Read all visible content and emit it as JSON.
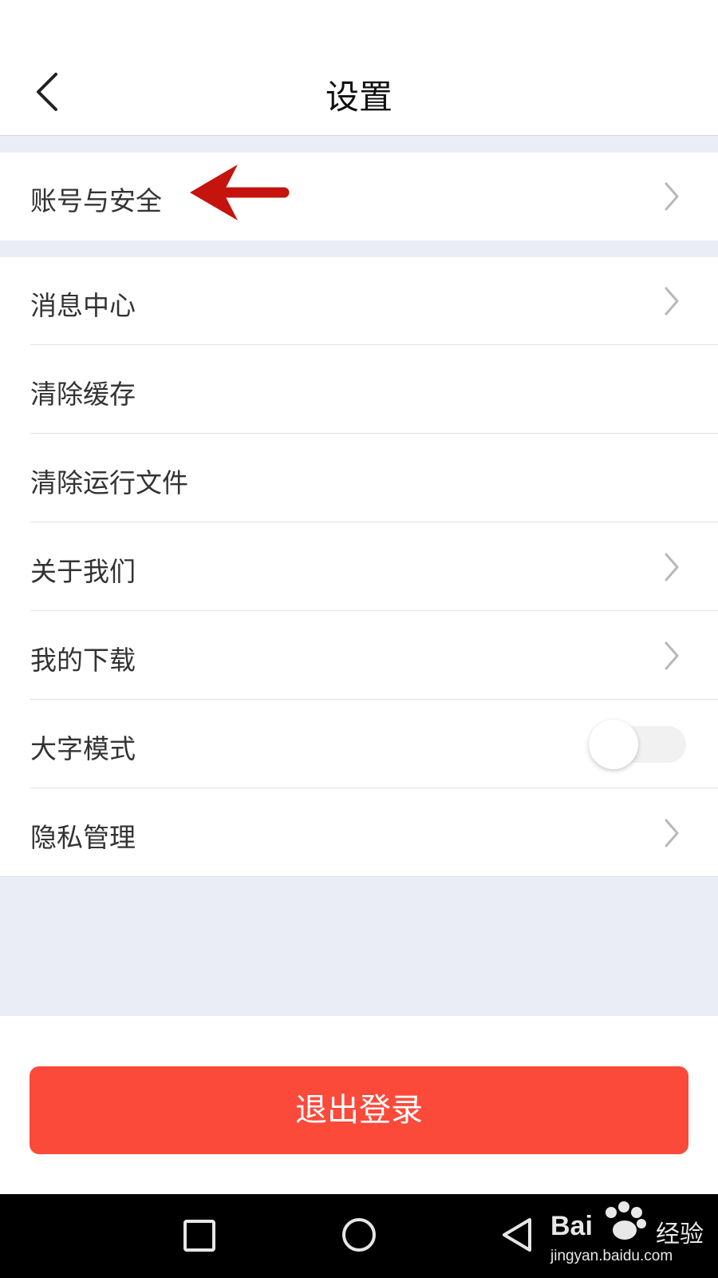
{
  "header": {
    "title": "设置",
    "back_icon": "chevron-left-icon"
  },
  "rows": [
    {
      "label": "账号与安全",
      "trailing": "chevron-right-icon"
    },
    {
      "label": "消息中心",
      "trailing": "chevron-right-icon"
    },
    {
      "label": "清除缓存",
      "trailing": ""
    },
    {
      "label": "清除运行文件",
      "trailing": ""
    },
    {
      "label": "关于我们",
      "trailing": "chevron-right-icon"
    },
    {
      "label": "我的下载",
      "trailing": "chevron-right-icon"
    },
    {
      "label": "大字模式",
      "trailing": "toggle",
      "toggle_on": false
    },
    {
      "label": "隐私管理",
      "trailing": "chevron-right-icon"
    }
  ],
  "logout": {
    "label": "退出登录",
    "color": "#fb4a3a"
  },
  "annotation": {
    "icon": "red-arrow-icon",
    "color": "#c4140d"
  },
  "system_nav": {
    "icons": [
      "recent-apps-icon",
      "home-icon",
      "back-icon"
    ]
  },
  "watermark": {
    "brand": "Bai",
    "suffix": "经验",
    "url": "jingyan.baidu.com",
    "logo_icon": "paw-icon"
  },
  "colors": {
    "background_gray": "#eaedf5",
    "divider": "#e2e2e2",
    "text": "#333333"
  }
}
